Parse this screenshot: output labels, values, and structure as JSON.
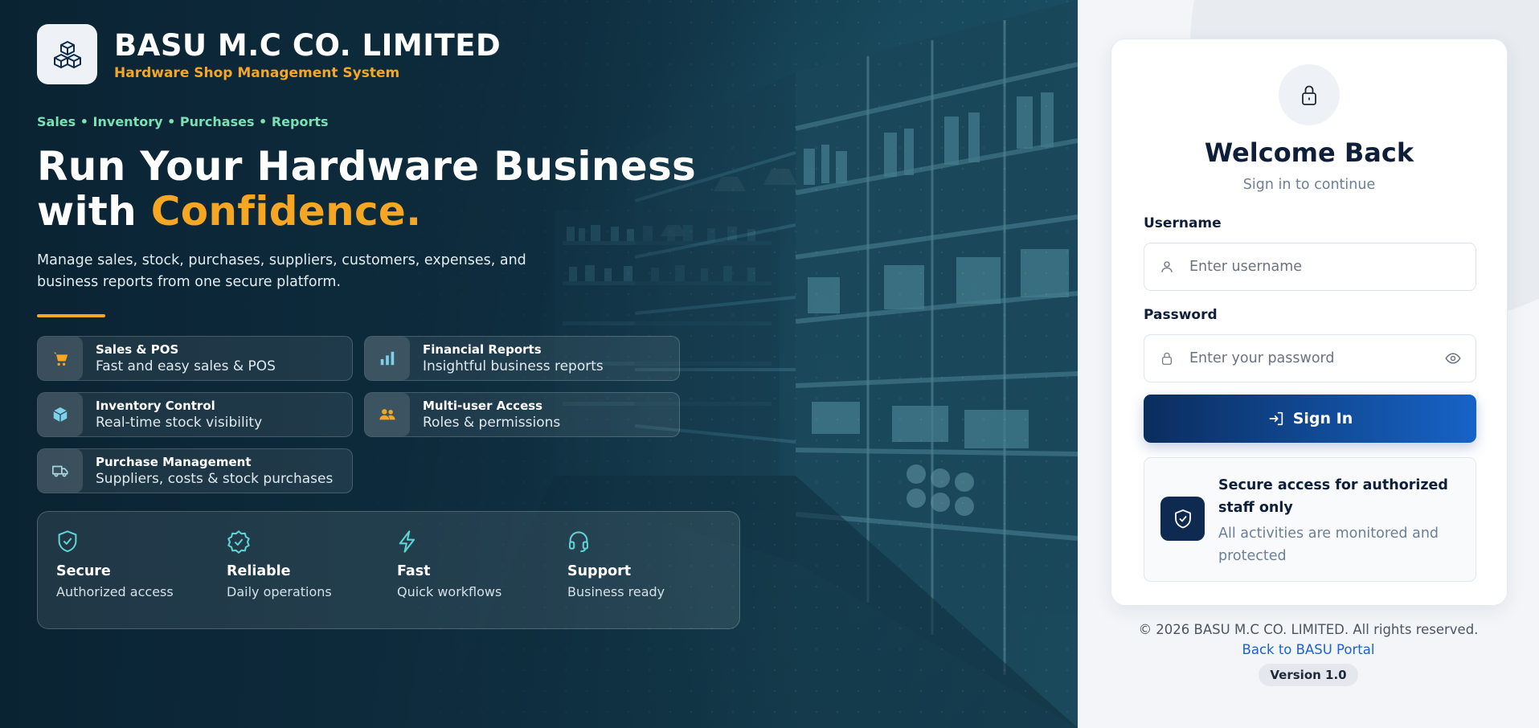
{
  "colors": {
    "accent": "#f5a623",
    "kicker": "#7be0b4",
    "primary": "#0b2d5e",
    "primary_end": "#1663c7",
    "link": "#1a63d1"
  },
  "brand": {
    "name": "BASU M.C CO. LIMITED",
    "tagline": "Hardware Shop Management System",
    "logo_icon": "cubes-icon"
  },
  "hero": {
    "kicker": "Sales • Inventory • Purchases • Reports",
    "headline_line1": "Run Your Hardware Business",
    "headline_with": "with",
    "headline_accent": "Confidence.",
    "description": "Manage sales, stock, purchases, suppliers, customers, expenses, and business reports from one secure platform."
  },
  "features": [
    {
      "title": "Sales & POS",
      "subtitle": "Fast and easy sales & POS",
      "icon": "cart-icon"
    },
    {
      "title": "Financial Reports",
      "subtitle": "Insightful business reports",
      "icon": "bar-chart-icon"
    },
    {
      "title": "Inventory Control",
      "subtitle": "Real-time stock visibility",
      "icon": "box-icon"
    },
    {
      "title": "Multi-user Access",
      "subtitle": "Roles & permissions",
      "icon": "users-icon"
    },
    {
      "title": "Purchase Management",
      "subtitle": "Suppliers, costs & stock purchases",
      "icon": "truck-icon"
    }
  ],
  "stats": [
    {
      "title": "Secure",
      "subtitle": "Authorized access",
      "icon": "shield-check-icon"
    },
    {
      "title": "Reliable",
      "subtitle": "Daily operations",
      "icon": "badge-check-icon"
    },
    {
      "title": "Fast",
      "subtitle": "Quick workflows",
      "icon": "lightning-icon"
    },
    {
      "title": "Support",
      "subtitle": "Business ready",
      "icon": "headset-icon"
    }
  ],
  "login": {
    "title": "Welcome Back",
    "subtitle": "Sign in to continue",
    "username_label": "Username",
    "username_placeholder": "Enter username",
    "username_value": "",
    "password_label": "Password",
    "password_placeholder": "Enter your password",
    "password_value": "",
    "submit_label": "Sign In",
    "notice_title": "Secure access for authorized staff only",
    "notice_subtitle": "All activities are monitored and protected"
  },
  "footer": {
    "copyright": "© 2026 BASU M.C CO. LIMITED. All rights reserved.",
    "portal_link": "Back to BASU Portal",
    "version": "Version 1.0"
  }
}
